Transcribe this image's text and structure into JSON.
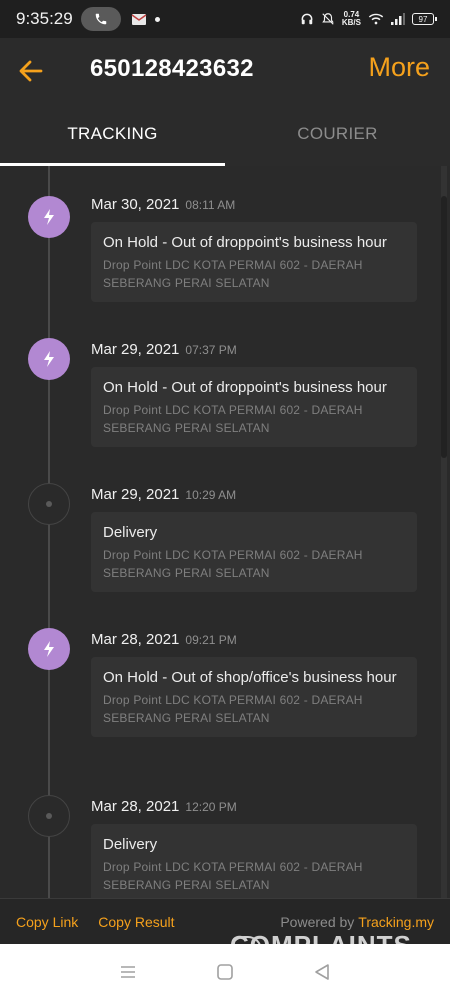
{
  "status_bar": {
    "time": "9:35:29",
    "net_speed_value": "0.74",
    "net_speed_unit": "KB/S",
    "battery": "97"
  },
  "header": {
    "tracking_number": "650128423632",
    "more_label": "More"
  },
  "tabs": [
    {
      "label": "TRACKING",
      "active": true
    },
    {
      "label": "COURIER",
      "active": false
    }
  ],
  "events": [
    {
      "date": "Mar 30, 2021",
      "time": "08:11 AM",
      "status": "On Hold - Out of droppoint's business hour",
      "location": "Drop Point LDC KOTA PERMAI 602 - DAERAH SEBERANG PERAI SELATAN",
      "icon": "lightning-icon"
    },
    {
      "date": "Mar 29, 2021",
      "time": "07:37 PM",
      "status": "On Hold - Out of droppoint's business hour",
      "location": "Drop Point LDC KOTA PERMAI 602 - DAERAH SEBERANG PERAI SELATAN",
      "icon": "lightning-icon"
    },
    {
      "date": "Mar 29, 2021",
      "time": "10:29 AM",
      "status": "Delivery",
      "location": "Drop Point LDC KOTA PERMAI 602 - DAERAH SEBERANG PERAI SELATAN",
      "icon": "dot-icon"
    },
    {
      "date": "Mar 28, 2021",
      "time": "09:21 PM",
      "status": "On Hold - Out of shop/office's business hour",
      "location": "Drop Point LDC KOTA PERMAI 602 - DAERAH SEBERANG PERAI SELATAN",
      "icon": "lightning-icon"
    },
    {
      "date": "Mar 28, 2021",
      "time": "12:20 PM",
      "status": "Delivery",
      "location": "Drop Point LDC KOTA PERMAI 602 - DAERAH SEBERANG PERAI SELATAN",
      "icon": "dot-icon"
    }
  ],
  "bottom_bar": {
    "copy_link": "Copy Link",
    "copy_result": "Copy Result",
    "powered_by": "Powered by",
    "brand": "Tracking.my"
  },
  "watermark": "COMPLAINTS",
  "colors": {
    "accent": "#f5a11c",
    "onhold_badge": "#b288d2",
    "background": "#262626"
  }
}
